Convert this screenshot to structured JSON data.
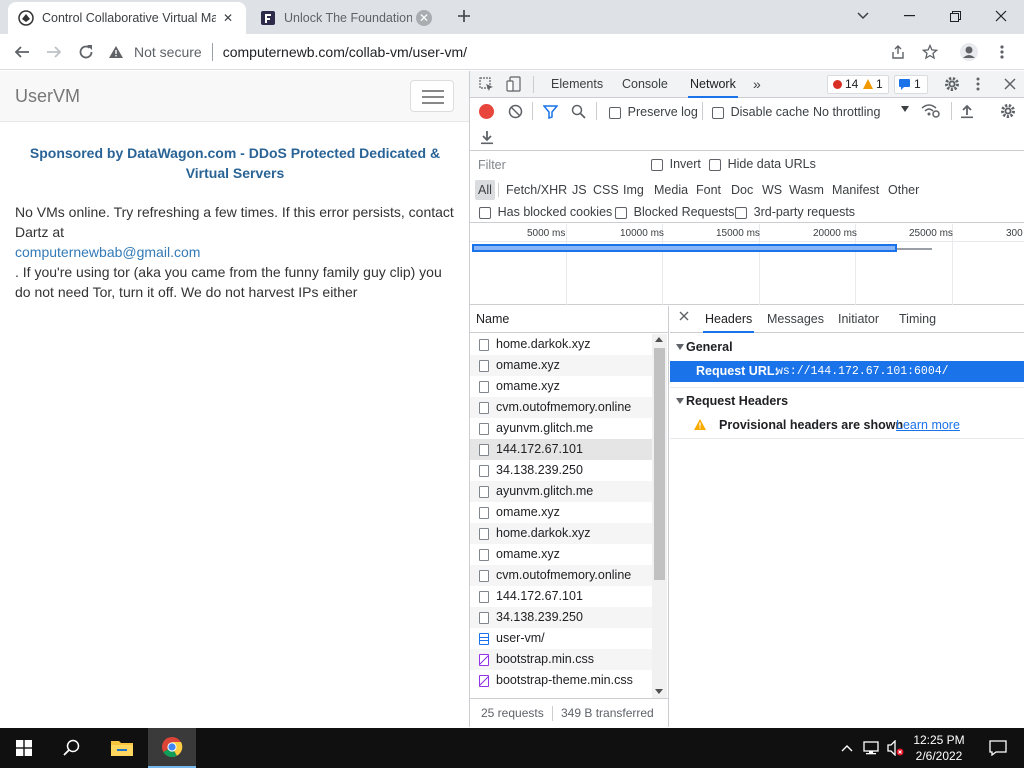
{
  "browser": {
    "tabs": [
      {
        "title": "Control Collaborative Virtual Ma",
        "icon": "collabvm-logo-icon",
        "active": true
      },
      {
        "title": "Unlock The Foundation",
        "icon": "foundation-logo-icon",
        "active": false
      }
    ],
    "address": {
      "security": "Not secure",
      "url": "computernewb.com/collab-vm/user-vm/"
    }
  },
  "page": {
    "brand": "UserVM",
    "sponsor": "Sponsored by DataWagon.com - DDoS Protected Dedicated & Virtual Servers",
    "message_1": "No VMs online. Try refreshing a few times. If this error persists, contact Dartz at",
    "message_link": "computernewbab@gmail.com",
    "message_2": ". If you're using tor (aka you came from the funny family guy clip) you do not need Tor, turn it off. We do not harvest IPs either"
  },
  "devtools": {
    "tabs": [
      "Elements",
      "Console",
      "Network"
    ],
    "active_tab": "Network",
    "errors": "14",
    "warnings": "1",
    "messages": "1",
    "toolbar": {
      "preserve_log": "Preserve log",
      "disable_cache": "Disable cache",
      "throttling": "No throttling"
    },
    "filter": {
      "placeholder": "Filter",
      "invert": "Invert",
      "hide_data_urls": "Hide data URLs",
      "types": [
        "All",
        "Fetch/XHR",
        "JS",
        "CSS",
        "Img",
        "Media",
        "Font",
        "Doc",
        "WS",
        "Wasm",
        "Manifest",
        "Other"
      ],
      "has_blocked_cookies": "Has blocked cookies",
      "blocked_requests": "Blocked Requests",
      "third_party": "3rd-party requests"
    },
    "timeline": {
      "ticks": [
        "5000 ms",
        "10000 ms",
        "15000 ms",
        "20000 ms",
        "25000 ms",
        "300"
      ]
    },
    "requests": {
      "header": "Name",
      "rows": [
        "home.darkok.xyz",
        "omame.xyz",
        "omame.xyz",
        "cvm.outofmemory.online",
        "ayunvm.glitch.me",
        "144.172.67.101",
        "34.138.239.250",
        "ayunvm.glitch.me",
        "omame.xyz",
        "home.darkok.xyz",
        "omame.xyz",
        "cvm.outofmemory.online",
        "144.172.67.101",
        "34.138.239.250",
        "user-vm/",
        "bootstrap.min.css",
        "bootstrap-theme.min.css"
      ],
      "count": "25 requests",
      "transferred": "349 B transferred"
    },
    "details": {
      "tabs": [
        "Headers",
        "Messages",
        "Initiator",
        "Timing"
      ],
      "general": "General",
      "request_url_label": "Request URL:",
      "request_url": "ws://144.172.67.101:6004/",
      "request_headers": "Request Headers",
      "provisional": "Provisional headers are shown",
      "learn_more": "Learn more"
    }
  },
  "taskbar": {
    "time": "12:25 PM",
    "date": "2/6/2022"
  }
}
